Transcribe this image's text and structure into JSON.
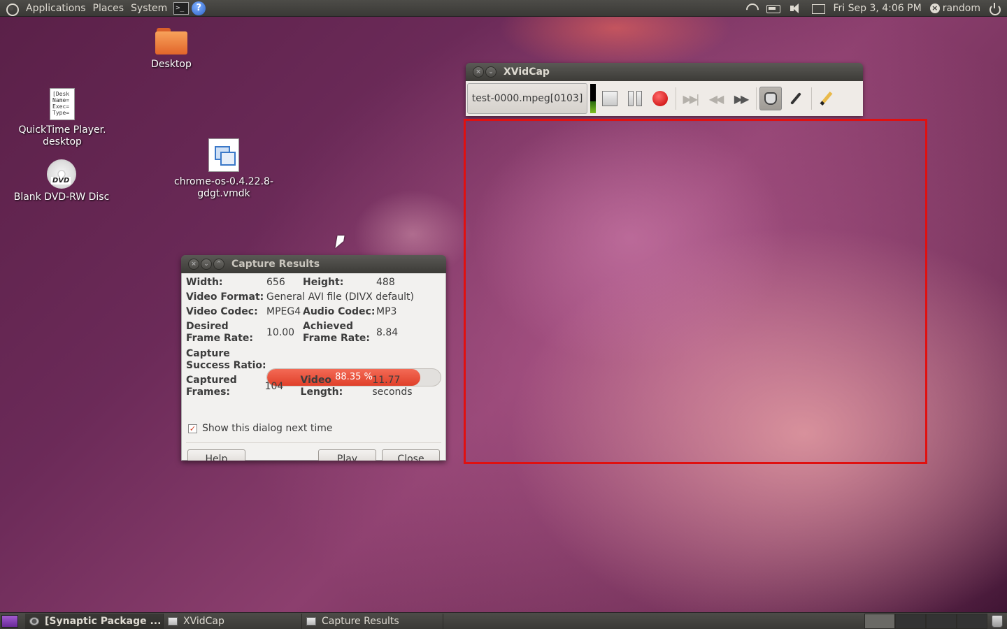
{
  "top_panel": {
    "menus": [
      "Applications",
      "Places",
      "System"
    ],
    "terminal_glyph": ">_",
    "help_glyph": "?",
    "clock": "Fri Sep  3,  4:06 PM",
    "user": "random"
  },
  "desktop_icons": {
    "desktop": "Desktop",
    "quicktime": "QuickTime Player.\ndesktop",
    "quicktime_preview": "[Desk\nName=\nExec=\nType=",
    "dvd": "Blank DVD-RW Disc",
    "dvd_badge": "DVD",
    "vmdk": "chrome-os-0.4.22.8-\ngdgt.vmdk"
  },
  "xvidcap": {
    "title": "XVidCap",
    "filename": "test-0000.mpeg[0103]"
  },
  "capture_results": {
    "title": "Capture Results",
    "width_label": "Width:",
    "width_value": "656",
    "height_label": "Height:",
    "height_value": "488",
    "video_format_label": "Video Format:",
    "video_format_value": "General AVI file (DIVX default)",
    "video_codec_label": "Video Codec:",
    "video_codec_value": "MPEG4",
    "audio_codec_label": "Audio Codec:",
    "audio_codec_value": "MP3",
    "desired_rate_label": "Desired\nFrame Rate:",
    "desired_rate_value": "10.00",
    "achieved_rate_label": "Achieved\nFrame Rate:",
    "achieved_rate_value": "8.84",
    "success_label": "Capture\nSuccess Ratio:",
    "success_text": "88.35 %",
    "success_fraction": 0.8835,
    "frames_label": "Captured\nFrames:",
    "frames_value": "104",
    "length_label": "Video\nLength:",
    "length_value": "11.77 seconds",
    "show_dialog_label": "Show this dialog next time",
    "show_dialog_checked": true,
    "help_button": "Help",
    "play_button": "Play",
    "close_button": "Close"
  },
  "taskbar": {
    "tasks": [
      "[Synaptic Package ...",
      "XVidCap",
      "Capture Results"
    ]
  },
  "colors": {
    "capture_frame": "#e01010",
    "progress": "#e0402a",
    "panel": "#3c3b37"
  }
}
